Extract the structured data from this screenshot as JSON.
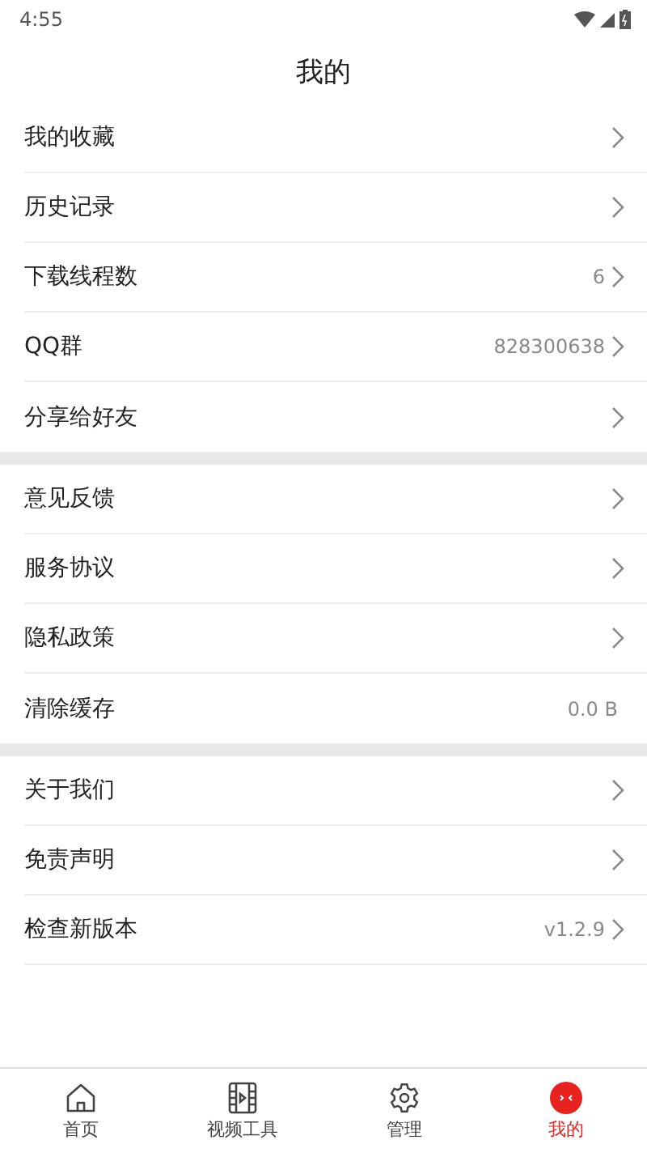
{
  "status_bar": {
    "time": "4:55"
  },
  "title": "我的",
  "sections": [
    {
      "items": [
        {
          "label": "我的收藏",
          "arrow": true
        },
        {
          "label": "历史记录",
          "arrow": true
        },
        {
          "label": "下载线程数",
          "value": "6",
          "arrow": true
        },
        {
          "label": "QQ群",
          "value": "828300638",
          "arrow": true
        },
        {
          "label": "分享给好友",
          "arrow": true
        }
      ]
    },
    {
      "items": [
        {
          "label": "意见反馈",
          "arrow": true
        },
        {
          "label": "服务协议",
          "arrow": true
        },
        {
          "label": "隐私政策",
          "arrow": true
        },
        {
          "label": "清除缓存",
          "value": "0.0 B",
          "arrow": false
        }
      ]
    },
    {
      "items": [
        {
          "label": "关于我们",
          "arrow": true
        },
        {
          "label": "免责声明",
          "arrow": true
        },
        {
          "label": "检查新版本",
          "value": "v1.2.9",
          "arrow": true
        }
      ],
      "end_divider": true
    }
  ],
  "bottom_nav": [
    {
      "kind": "home",
      "label": "首页",
      "selected": false
    },
    {
      "kind": "video",
      "label": "视频工具",
      "selected": false
    },
    {
      "kind": "settings",
      "label": "管理",
      "selected": false
    },
    {
      "kind": "me",
      "label": "我的",
      "selected": true
    }
  ]
}
